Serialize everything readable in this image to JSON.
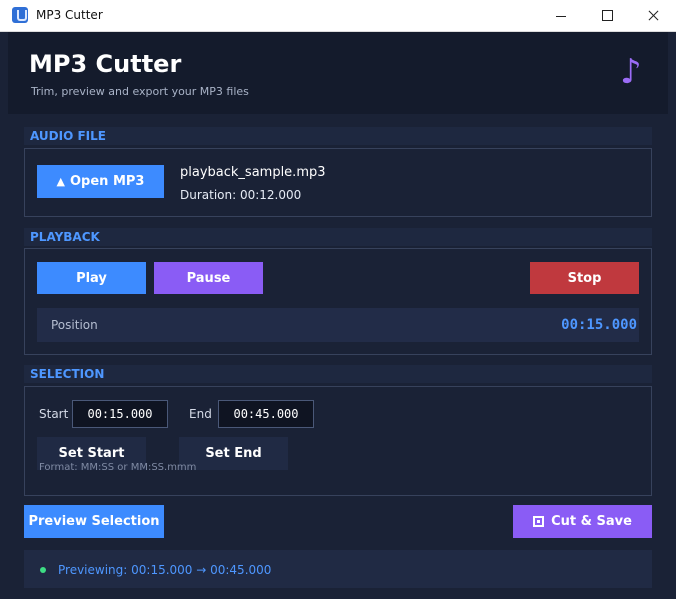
{
  "window": {
    "title": "MP3 Cutter"
  },
  "header": {
    "title": "MP3 Cutter",
    "subtitle": "Trim, preview and export your MP3 files",
    "icon": "music-note-icon",
    "accent": "#9b6cf6"
  },
  "audio_file": {
    "label": "AUDIO FILE",
    "open_button": "Open MP3",
    "file_name": "playback_sample.mp3",
    "duration": "Duration: 00:12.000"
  },
  "playback": {
    "label": "PLAYBACK",
    "play": "Play",
    "pause": "Pause",
    "stop": "Stop",
    "position_label": "Position",
    "position_value": "00:15.000"
  },
  "selection": {
    "label": "SELECTION",
    "start_label": "Start",
    "start_value": "00:15.000",
    "end_label": "End",
    "end_value": "00:45.000",
    "set_start": "Set Start",
    "set_end": "Set End",
    "format_hint": "Format: MM:SS or MM:SS.mmm"
  },
  "actions": {
    "preview": "Preview Selection",
    "cut_save": "Cut & Save"
  },
  "status": {
    "text": "Previewing: 00:15.000 → 00:45.000"
  },
  "colors": {
    "blue": "#3d8bff",
    "purple": "#8a5cf5",
    "red": "#c0393e",
    "background": "#1a2236"
  }
}
